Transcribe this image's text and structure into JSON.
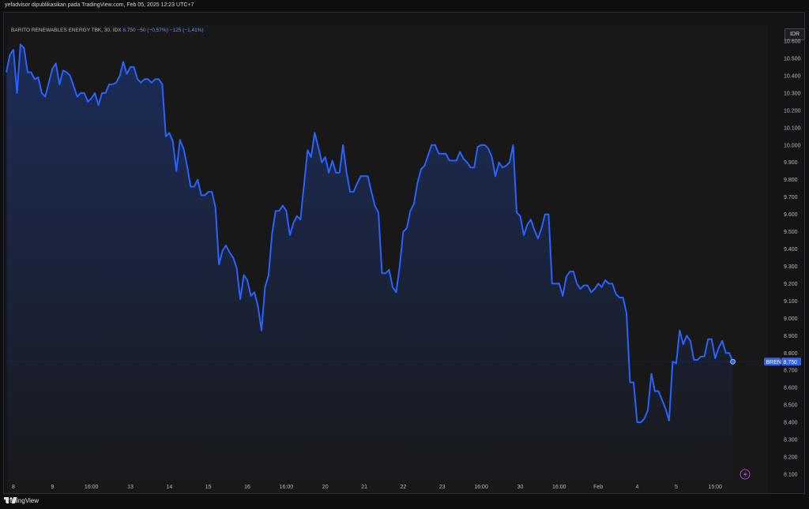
{
  "publisher_line": "yefadvisor dipublikasikan pada TradingView.com, Feb 05, 2025 12:23 UTC+7",
  "legend": {
    "name": "BARITO RENEWABLES ENERGY TBK, 30, IDX",
    "price": "8.750",
    "change_abs": "−50 (−0,57%)",
    "change_abs2": "−125 (−1,41%)"
  },
  "currency_button": "IDR",
  "price_tag": {
    "symbol": "BREN",
    "value": "8.750"
  },
  "footer": {
    "brand": "TradingView"
  },
  "colors": {
    "line": "#2962ff",
    "background": "#181818",
    "text": "#d1d4dc"
  },
  "chart_data": {
    "type": "area",
    "ylim": [
      8100,
      10600
    ],
    "grid": false,
    "y_ticks": [
      {
        "label": "10.600",
        "value": 10600
      },
      {
        "label": "10.500",
        "value": 10500
      },
      {
        "label": "10.400",
        "value": 10400
      },
      {
        "label": "10.300",
        "value": 10300
      },
      {
        "label": "10.200",
        "value": 10200
      },
      {
        "label": "10.100",
        "value": 10100
      },
      {
        "label": "10.000",
        "value": 10000
      },
      {
        "label": "9.900",
        "value": 9900
      },
      {
        "label": "9.800",
        "value": 9800
      },
      {
        "label": "9.700",
        "value": 9700
      },
      {
        "label": "9.600",
        "value": 9600
      },
      {
        "label": "9.500",
        "value": 9500
      },
      {
        "label": "9.400",
        "value": 9400
      },
      {
        "label": "9.300",
        "value": 9300
      },
      {
        "label": "9.200",
        "value": 9200
      },
      {
        "label": "9.100",
        "value": 9100
      },
      {
        "label": "9.000",
        "value": 9000
      },
      {
        "label": "8.900",
        "value": 8900
      },
      {
        "label": "8.800",
        "value": 8800
      },
      {
        "label": "8.700",
        "value": 8700
      },
      {
        "label": "8.600",
        "value": 8600
      },
      {
        "label": "8.500",
        "value": 8500
      },
      {
        "label": "8.400",
        "value": 8400
      },
      {
        "label": "8.300",
        "value": 8300
      },
      {
        "label": "8.200",
        "value": 8200
      },
      {
        "label": "8.100",
        "value": 8100
      }
    ],
    "x_ticks": [
      {
        "label": "8",
        "index": 2
      },
      {
        "label": "9",
        "index": 13
      },
      {
        "label": "16:00",
        "index": 24
      },
      {
        "label": "13",
        "index": 35
      },
      {
        "label": "14",
        "index": 46
      },
      {
        "label": "15",
        "index": 57
      },
      {
        "label": "16",
        "index": 68
      },
      {
        "label": "16:00",
        "index": 79
      },
      {
        "label": "20",
        "index": 90
      },
      {
        "label": "21",
        "index": 101
      },
      {
        "label": "22",
        "index": 112
      },
      {
        "label": "23",
        "index": 123
      },
      {
        "label": "16:00",
        "index": 134
      },
      {
        "label": "30",
        "index": 145
      },
      {
        "label": "16:00",
        "index": 156
      },
      {
        "label": "Feb",
        "index": 167
      },
      {
        "label": "4",
        "index": 178
      },
      {
        "label": "5",
        "index": 189
      },
      {
        "label": "15:00",
        "index": 200
      }
    ],
    "values": [
      10420,
      10520,
      10550,
      10300,
      10580,
      10560,
      10420,
      10420,
      10380,
      10390,
      10300,
      10280,
      10360,
      10440,
      10470,
      10350,
      10430,
      10420,
      10400,
      10340,
      10280,
      10300,
      10300,
      10250,
      10270,
      10300,
      10230,
      10300,
      10300,
      10350,
      10350,
      10360,
      10400,
      10480,
      10410,
      10450,
      10450,
      10380,
      10360,
      10380,
      10380,
      10360,
      10380,
      10380,
      10350,
      10050,
      10070,
      10020,
      9850,
      10030,
      9980,
      9880,
      9760,
      9760,
      9800,
      9710,
      9710,
      9730,
      9730,
      9640,
      9310,
      9390,
      9420,
      9380,
      9350,
      9290,
      9110,
      9250,
      9220,
      9130,
      9150,
      9070,
      8930,
      9180,
      9250,
      9490,
      9620,
      9620,
      9650,
      9620,
      9480,
      9550,
      9590,
      9570,
      9770,
      9970,
      9930,
      10070,
      9990,
      9900,
      9930,
      9840,
      9910,
      9840,
      9840,
      10000,
      9840,
      9730,
      9730,
      9780,
      9820,
      9820,
      9820,
      9730,
      9650,
      9610,
      9260,
      9260,
      9280,
      9180,
      9150,
      9300,
      9500,
      9520,
      9620,
      9660,
      9780,
      9860,
      9880,
      9940,
      10000,
      10000,
      9950,
      9950,
      9950,
      9910,
      9910,
      9910,
      9960,
      9920,
      9900,
      9870,
      9870,
      9990,
      10000,
      10000,
      9980,
      9930,
      9820,
      9900,
      9870,
      9880,
      9900,
      10000,
      9610,
      9590,
      9480,
      9540,
      9570,
      9510,
      9460,
      9520,
      9600,
      9600,
      9200,
      9200,
      9200,
      9130,
      9240,
      9270,
      9270,
      9200,
      9170,
      9190,
      9190,
      9150,
      9170,
      9200,
      9180,
      9220,
      9200,
      9200,
      9140,
      9120,
      9120,
      9030,
      8630,
      8630,
      8400,
      8400,
      8420,
      8470,
      8680,
      8580,
      8580,
      8530,
      8480,
      8410,
      8750,
      8740,
      8930,
      8850,
      8900,
      8870,
      8760,
      8760,
      8780,
      8780,
      8880,
      8880,
      8770,
      8830,
      8870,
      8800,
      8800,
      8750
    ]
  }
}
